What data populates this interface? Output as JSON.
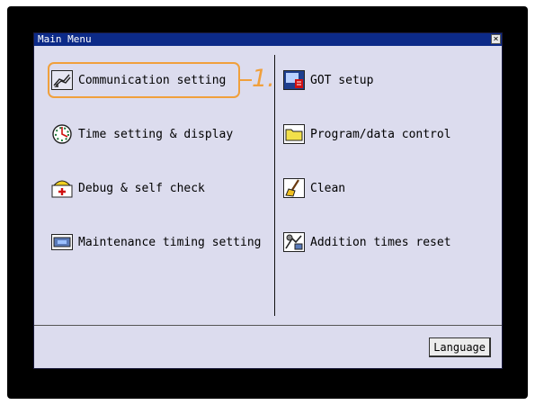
{
  "window": {
    "title": "Main Menu",
    "close_glyph": "×"
  },
  "menu_left": [
    {
      "label": "Communication setting",
      "icon": "communication-setting-icon"
    },
    {
      "label": "Time setting & display",
      "icon": "clock-icon"
    },
    {
      "label": "Debug & self check",
      "icon": "debug-check-icon"
    },
    {
      "label": "Maintenance timing setting",
      "icon": "maintenance-icon"
    }
  ],
  "menu_right": [
    {
      "label": "GOT setup",
      "icon": "got-setup-icon"
    },
    {
      "label": "Program/data control",
      "icon": "folder-icon"
    },
    {
      "label": "Clean",
      "icon": "broom-icon"
    },
    {
      "label": "Addition times reset",
      "icon": "reset-icon"
    }
  ],
  "footer": {
    "language_label": "Language"
  },
  "annotation": {
    "step_label": "1."
  },
  "colors": {
    "titlebar": "#0c2a88",
    "background": "#dcdcee",
    "callout": "#f0a03c"
  }
}
